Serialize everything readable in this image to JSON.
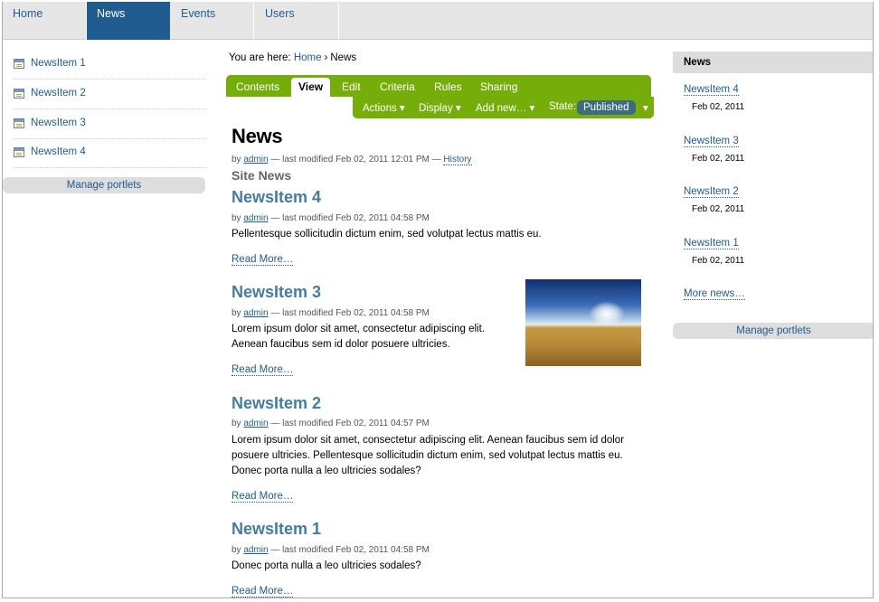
{
  "topnav": {
    "tabs": [
      {
        "label": "Home"
      },
      {
        "label": "News"
      },
      {
        "label": "Events"
      },
      {
        "label": "Users"
      }
    ]
  },
  "left_portlet": {
    "items": [
      {
        "label": "NewsItem 1"
      },
      {
        "label": "NewsItem 2"
      },
      {
        "label": "NewsItem 3"
      },
      {
        "label": "NewsItem 4"
      }
    ],
    "manage_label": "Manage portlets"
  },
  "breadcrumb": {
    "prefix": "You are here:",
    "home": "Home",
    "separator": "›",
    "current": "News"
  },
  "toolbar": {
    "tabs": {
      "contents": "Contents",
      "view": "View",
      "edit": "Edit",
      "criteria": "Criteria",
      "rules": "Rules",
      "sharing": "Sharing"
    },
    "actions": "Actions ▾",
    "display": "Display ▾",
    "add_new": "Add new… ▾",
    "state_label": "State:",
    "state_value": "Published",
    "state_arrow": "▾"
  },
  "page": {
    "title": "News",
    "byline_by": "by",
    "byline_author": "admin",
    "byline_modified": "— last modified Feb 02, 2011 12:01 PM —",
    "byline_history": "History",
    "section_title": "Site News"
  },
  "news_items": [
    {
      "title": "NewsItem 4",
      "by": "by",
      "author": "admin",
      "modified": "— last modified Feb 02, 2011 04:58 PM",
      "desc_lines": [
        "Pellentesque sollicitudin dictum enim, sed volutpat lectus mattis eu."
      ],
      "read_more": "Read More…"
    },
    {
      "title": "NewsItem 3",
      "by": "by",
      "author": "admin",
      "modified": "— last modified Feb 02, 2011 04:58 PM",
      "desc_lines": [
        "Lorem ipsum dolor sit amet, consectetur adipiscing elit.",
        "Aenean faucibus sem id dolor posuere ultricies."
      ],
      "read_more": "Read More…"
    },
    {
      "title": "NewsItem 2",
      "by": "by",
      "author": "admin",
      "modified": "— last modified Feb 02, 2011 04:57 PM",
      "desc_lines": [
        "Lorem ipsum dolor sit amet, consectetur adipiscing elit. Aenean faucibus sem id dolor",
        "posuere ultricies. Pellentesque sollicitudin dictum enim, sed volutpat lectus mattis eu.",
        "Donec porta nulla a leo ultricies sodales?"
      ],
      "read_more": "Read More…"
    },
    {
      "title": "NewsItem 1",
      "by": "by",
      "author": "admin",
      "modified": "— last modified Feb 02, 2011 04:58 PM",
      "desc_lines": [
        "Donec porta nulla a leo ultricies sodales?"
      ],
      "read_more": "Read More…"
    }
  ],
  "right_portlet": {
    "header": "News",
    "items": [
      {
        "label": "NewsItem 4",
        "date": "Feb 02, 2011"
      },
      {
        "label": "NewsItem 3",
        "date": "Feb 02, 2011"
      },
      {
        "label": "NewsItem 2",
        "date": "Feb 02, 2011"
      },
      {
        "label": "NewsItem 1",
        "date": "Feb 02, 2011"
      }
    ],
    "more_label": "More news…",
    "manage_label": "Manage portlets"
  },
  "colors": {
    "nav_active": "#205c90",
    "toolbar_green": "#75ad0a",
    "title_blue": "#437da1",
    "state_pill": "#3e6b7e"
  }
}
